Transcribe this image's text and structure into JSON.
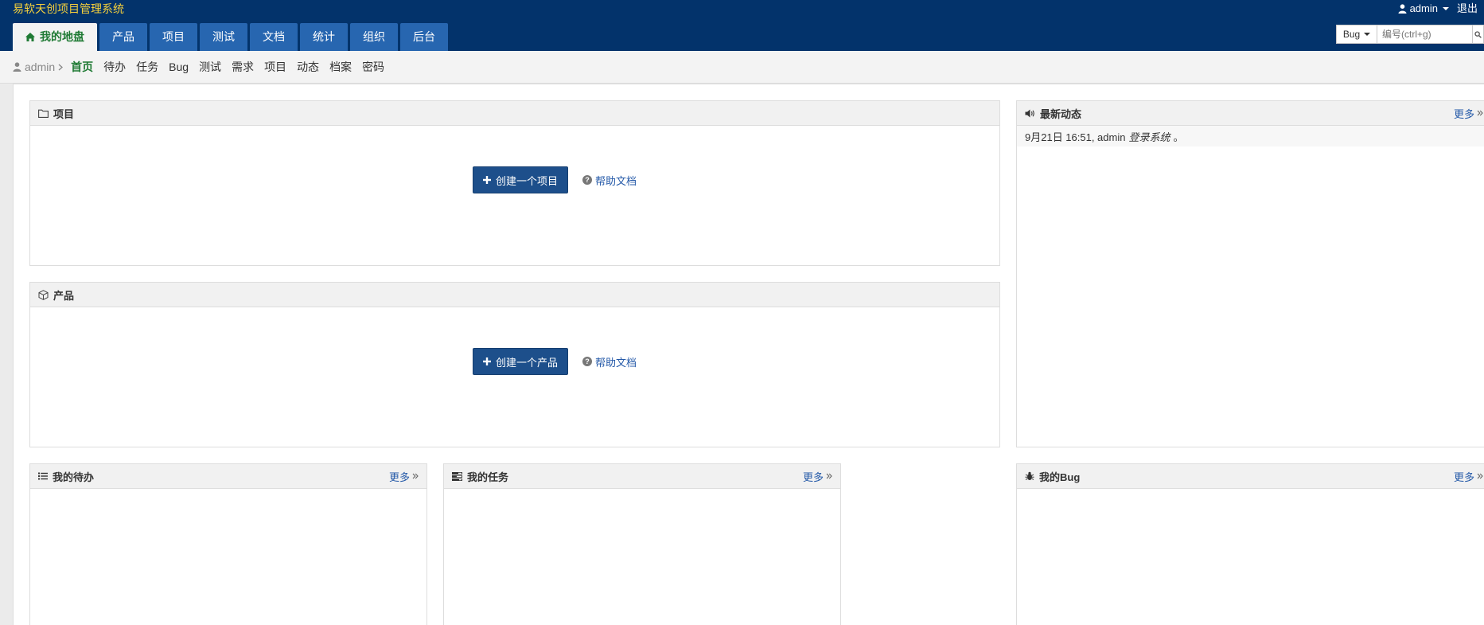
{
  "header": {
    "brand": "易软天创项目管理系统",
    "user": "admin",
    "logout": "退出"
  },
  "mainnav": [
    {
      "label": "我的地盘",
      "active": true
    },
    {
      "label": "产品"
    },
    {
      "label": "项目"
    },
    {
      "label": "测试"
    },
    {
      "label": "文档"
    },
    {
      "label": "统计"
    },
    {
      "label": "组织"
    },
    {
      "label": "后台"
    }
  ],
  "search": {
    "type": "Bug",
    "placeholder": "编号(ctrl+g)"
  },
  "subnav": {
    "crumb": "admin",
    "items": [
      {
        "label": "首页",
        "active": true
      },
      {
        "label": "待办"
      },
      {
        "label": "任务"
      },
      {
        "label": "Bug"
      },
      {
        "label": "测试"
      },
      {
        "label": "需求"
      },
      {
        "label": "项目"
      },
      {
        "label": "动态"
      },
      {
        "label": "档案"
      },
      {
        "label": "密码"
      }
    ]
  },
  "panels": {
    "project": {
      "title": "项目",
      "create_label": "创建一个项目",
      "help_label": "帮助文档"
    },
    "product": {
      "title": "产品",
      "create_label": "创建一个产品",
      "help_label": "帮助文档"
    },
    "dynamic": {
      "title": "最新动态",
      "more": "更多",
      "entry_time": "9月21日 16:51, admin",
      "entry_action": "登录系统",
      "entry_end": "。"
    },
    "todo": {
      "title": "我的待办",
      "more": "更多"
    },
    "task": {
      "title": "我的任务",
      "more": "更多"
    },
    "bug": {
      "title": "我的Bug",
      "more": "更多"
    }
  },
  "colors": {
    "header_bg": "#03336b",
    "brand": "#f5d03b",
    "tab_bg": "#2766b0",
    "active_green": "#1f7a34",
    "primary_button": "#1d4f8b",
    "link": "#2459a8"
  }
}
